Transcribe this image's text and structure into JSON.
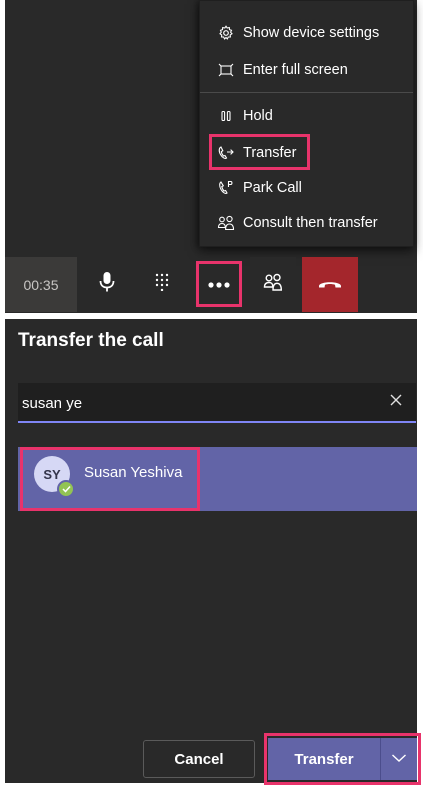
{
  "menu": {
    "items": [
      {
        "label": "Show device settings",
        "icon": "gear-icon"
      },
      {
        "label": "Enter full screen",
        "icon": "fullscreen-icon"
      },
      {
        "label": "Hold",
        "icon": "pause-icon"
      },
      {
        "label": "Transfer",
        "icon": "call-transfer-icon"
      },
      {
        "label": "Park Call",
        "icon": "park-call-icon"
      },
      {
        "label": "Consult then transfer",
        "icon": "consult-transfer-icon"
      }
    ]
  },
  "callbar": {
    "timer": "00:35",
    "buttons": [
      "microphone-icon",
      "dialpad-icon",
      "more-options-icon",
      "people-icon",
      "end-call-icon"
    ]
  },
  "dialog": {
    "title": "Transfer the call",
    "search_value": "susan ye",
    "result": {
      "initials": "SY",
      "name": "Susan Yeshiva",
      "presence": "available"
    },
    "cancel_label": "Cancel",
    "transfer_label": "Transfer"
  },
  "colors": {
    "accent": "#6264a7",
    "highlight": "#e8336b",
    "end_call": "#a4262c",
    "presence_available": "#92c353"
  }
}
